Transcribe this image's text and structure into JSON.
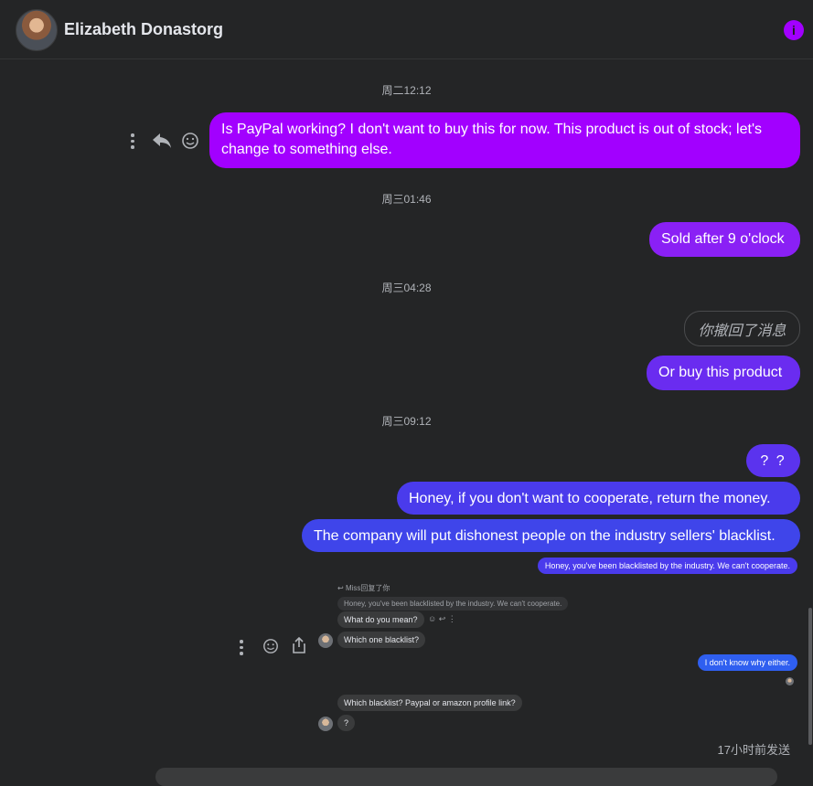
{
  "header": {
    "contact_name": "Elizabeth Donastorg",
    "info_icon": "info-icon",
    "info_glyph": "i",
    "accent_color": "#a200ff"
  },
  "messages": {
    "stamp1": "周二12:12",
    "msg1": "Is PayPal working? I don't want to buy this for now. This product is out of stock; let's change to something else.",
    "stamp2": "周三01:46",
    "msg2": "Sold after 9 o'clock",
    "stamp3": "周三04:28",
    "recalled": "你撤回了消息",
    "msg3": "Or buy this product",
    "stamp4": "周三09:12",
    "msg4": "? ?",
    "msg5": "Honey, if you don't want to cooperate, return the money.",
    "msg6": "The company will put dishonest people on the industry sellers' blacklist.",
    "status": "17小时前发送"
  },
  "bubble_colors": {
    "msg1": "#a200ff",
    "msg2": "#8a20f5",
    "msg3": "#6a2cf0",
    "msg4": "#5b33ee",
    "msg5": "#4a3bec",
    "msg6": "#3f45ea"
  },
  "embedded_screenshot": {
    "top_blue": "Honey, you've been blacklisted by the industry. We can't cooperate.",
    "reply_header": "Miss回复了你",
    "quoted": "Honey, you've been blacklisted by the industry. We can't cooperate.",
    "reply": "What do you mean?",
    "q1": "Which one blacklist?",
    "my_blue": "I don't know why either.",
    "q2": "Which blacklist? Paypal or amazon profile link?",
    "q3": "?"
  }
}
